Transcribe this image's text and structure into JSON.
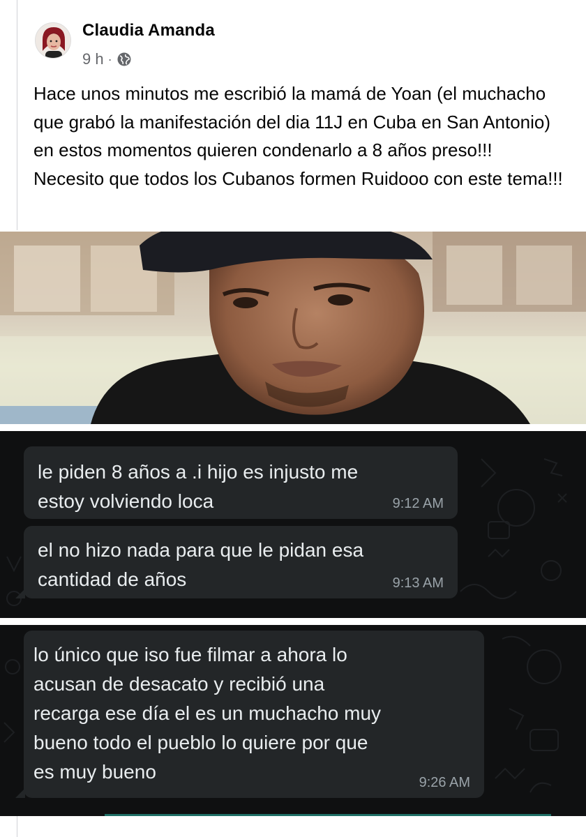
{
  "post": {
    "author": "Claudia Amanda",
    "time_ago": "9 h",
    "separator": "·",
    "privacy_icon": "globe-icon",
    "text": "Hace unos minutos me escribió la mamá de Yoan (el muchacho que grabó la manifestación del dia 11J en Cuba en San Antonio) en estos momentos quieren condenarlo a 8 años preso!!! Necesito que todos los Cubanos formen Ruidooo con este tema!!!"
  },
  "chat": {
    "messages": [
      {
        "text": "le piden 8 años a .i hijo es injusto me\nestoy volviendo loca",
        "time": "9:12 AM"
      },
      {
        "text": "el no hizo nada para que le pidan esa\ncantidad de años",
        "time": "9:13 AM"
      },
      {
        "text": "lo único que iso fue filmar a ahora lo\nacusan de desacato y  recibió una\nrecarga ese día  el es un muchacho muy\nbueno todo el pueblo lo quiere  por que\nes muy bueno",
        "time": "9:26 AM"
      }
    ]
  },
  "colors": {
    "chat_background": "#0f1011",
    "bubble": "#232628",
    "bubble_text": "#e9edef",
    "timestamp": "#9aa3a9",
    "meta_text": "#65676b"
  }
}
